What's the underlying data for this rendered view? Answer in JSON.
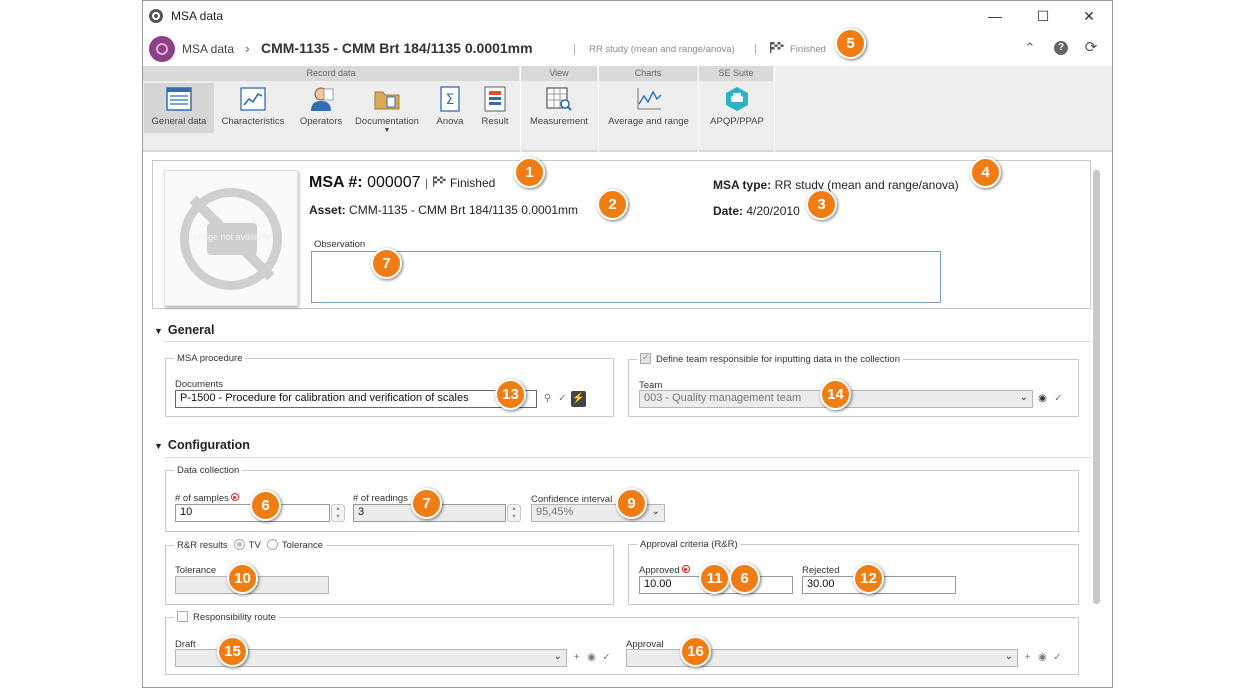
{
  "window": {
    "title": "MSA data"
  },
  "header": {
    "breadcrumb": "MSA data",
    "title": "CMM-1135 - CMM Brt 184/1135 0.0001mm",
    "subtitle": "RR study (mean and range/anova)",
    "status": "Finished"
  },
  "ribbon": {
    "groups": [
      "Record data",
      "View",
      "Charts",
      "SE Suite"
    ],
    "buttons": {
      "general_data": "General data",
      "characteristics": "Characteristics",
      "operators": "Operators",
      "documentation": "Documentation",
      "anova": "Anova",
      "result": "Result",
      "measurement": "Measurement",
      "average_range": "Average and range",
      "apqp": "APQP/PPAP"
    }
  },
  "record": {
    "image_placeholder": "Image not available",
    "msa_label": "MSA #:",
    "msa_number": "000007",
    "status": "Finished",
    "asset_label": "Asset:",
    "asset_value": "CMM-1135 - CMM Brt 184/1135 0.0001mm",
    "type_label": "MSA type:",
    "type_value": "RR study (mean and range/anova)",
    "date_label": "Date:",
    "date_value": "4/20/2010",
    "observation_label": "Observation",
    "observation_value": ""
  },
  "general": {
    "section_title": "General",
    "procedure_legend": "MSA procedure",
    "documents_label": "Documents",
    "documents_value": "P-1500 - Procedure for calibration and verification of scales",
    "team_checkbox_label": "Define team responsible for inputting data in the collection",
    "team_label": "Team",
    "team_value": "003 - Quality management team"
  },
  "configuration": {
    "section_title": "Configuration",
    "data_collection_legend": "Data collection",
    "samples_label": "# of samples",
    "samples_value": "10",
    "readings_label": "# of readings",
    "readings_value": "3",
    "confidence_label": "Confidence interval",
    "confidence_value": "95,45%",
    "rr_results_legend": "R&R results",
    "rr_option_tv": "TV",
    "rr_option_tolerance": "Tolerance",
    "tolerance_label": "Tolerance",
    "tolerance_value": "",
    "approval_legend": "Approval criteria (R&R)",
    "approved_label": "Approved",
    "approved_value": "10.00",
    "rejected_label": "Rejected",
    "rejected_value": "30.00",
    "route_legend": "Responsibility route",
    "draft_label": "Draft",
    "draft_value": "",
    "approval_label": "Approval",
    "approval_value": ""
  },
  "callouts": {
    "c1": "1",
    "c2": "2",
    "c3": "3",
    "c4": "4",
    "c5": "5",
    "c6a": "6",
    "c7a": "7",
    "c6b": "6",
    "c7b": "7",
    "c9": "9",
    "c10": "10",
    "c11": "11",
    "c6c": "6",
    "c12": "12",
    "c13": "13",
    "c14": "14",
    "c15": "15",
    "c16": "16"
  },
  "colors": {
    "callout": "#f07d14",
    "ribbon_bg": "#eeeeee",
    "ribbon_group_header": "#d9d9d9",
    "icon_blue": "#2f6db3",
    "apqp_teal": "#2bb2c7",
    "logo_purple": "#8e3f86"
  },
  "icons": [
    "app-globe-icon",
    "minimize-icon",
    "maximize-icon",
    "close-icon",
    "collapse-icon",
    "help-icon",
    "refresh-icon",
    "finished-flag-icon",
    "search-icon",
    "clear-icon",
    "quick-action-icon",
    "binoculars-icon",
    "add-icon",
    "dropdown-chevron-icon",
    "required-icon"
  ]
}
